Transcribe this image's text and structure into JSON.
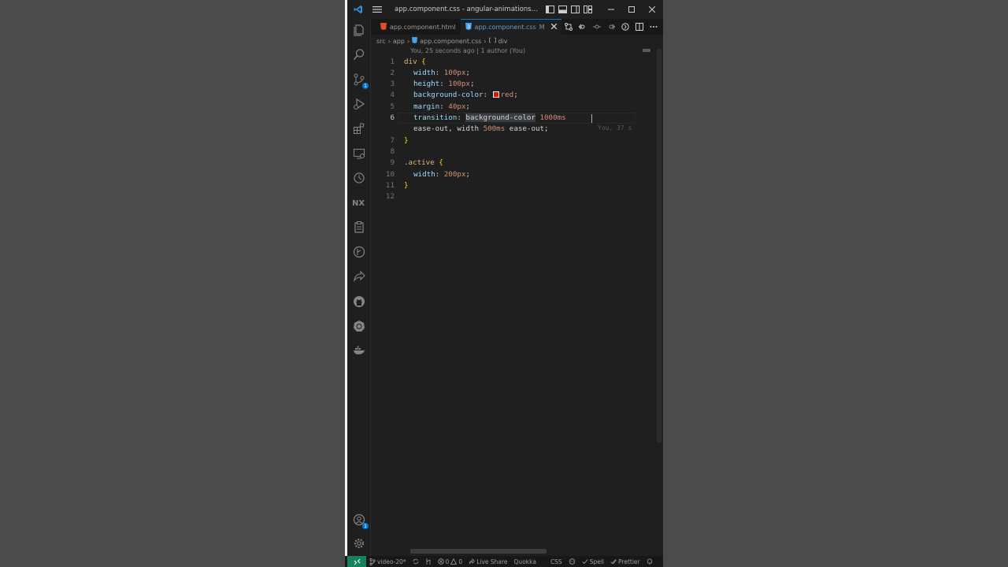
{
  "window": {
    "title": "app.component.css - angular-animations - Visual St..."
  },
  "tabs": [
    {
      "label": "app.component.html",
      "active": false
    },
    {
      "label": "app.component.css",
      "modified": "M",
      "active": true
    }
  ],
  "breadcrumb": [
    "src",
    "app",
    "app.component.css",
    "div"
  ],
  "blame_header": "You, 25 seconds ago | 1 author (You)",
  "inline_blame": "You, 37 s",
  "code_lines": [
    {
      "n": "1"
    },
    {
      "n": "2"
    },
    {
      "n": "3"
    },
    {
      "n": "4"
    },
    {
      "n": "5"
    },
    {
      "n": "6"
    },
    {
      "n": "7"
    },
    {
      "n": "8"
    },
    {
      "n": "9"
    },
    {
      "n": "10"
    },
    {
      "n": "11"
    },
    {
      "n": "12"
    }
  ],
  "code": {
    "l1_sel": "div",
    "l1_brace": " {",
    "l2_prop": "width",
    "l2_val": "100px",
    "l3_prop": "height",
    "l3_val": "100px",
    "l4_prop": "background-color",
    "l4_val": "red",
    "l5_prop": "margin",
    "l5_val": "40px",
    "l6_prop": "transition",
    "l6_val1": "background-color",
    "l6_val2": "1000ms",
    "l6b_val1": "ease-out",
    "l6b_val2": "width",
    "l6b_val3": "500ms",
    "l6b_val4": "ease-out",
    "l7": "}",
    "l9_sel": ".active",
    "l9_brace": " {",
    "l10_prop": "width",
    "l10_val": "200px",
    "l11": "}"
  },
  "status": {
    "branch": "video-20*",
    "errors": "0",
    "warnings": "0",
    "live_share": "Live Share",
    "quokka": "Quokka",
    "language": "CSS",
    "spell": "Spell",
    "prettier": "Prettier"
  },
  "colors": {
    "accent": "#0078d4",
    "remote": "#16825d",
    "swatch_red": "#e51400"
  }
}
